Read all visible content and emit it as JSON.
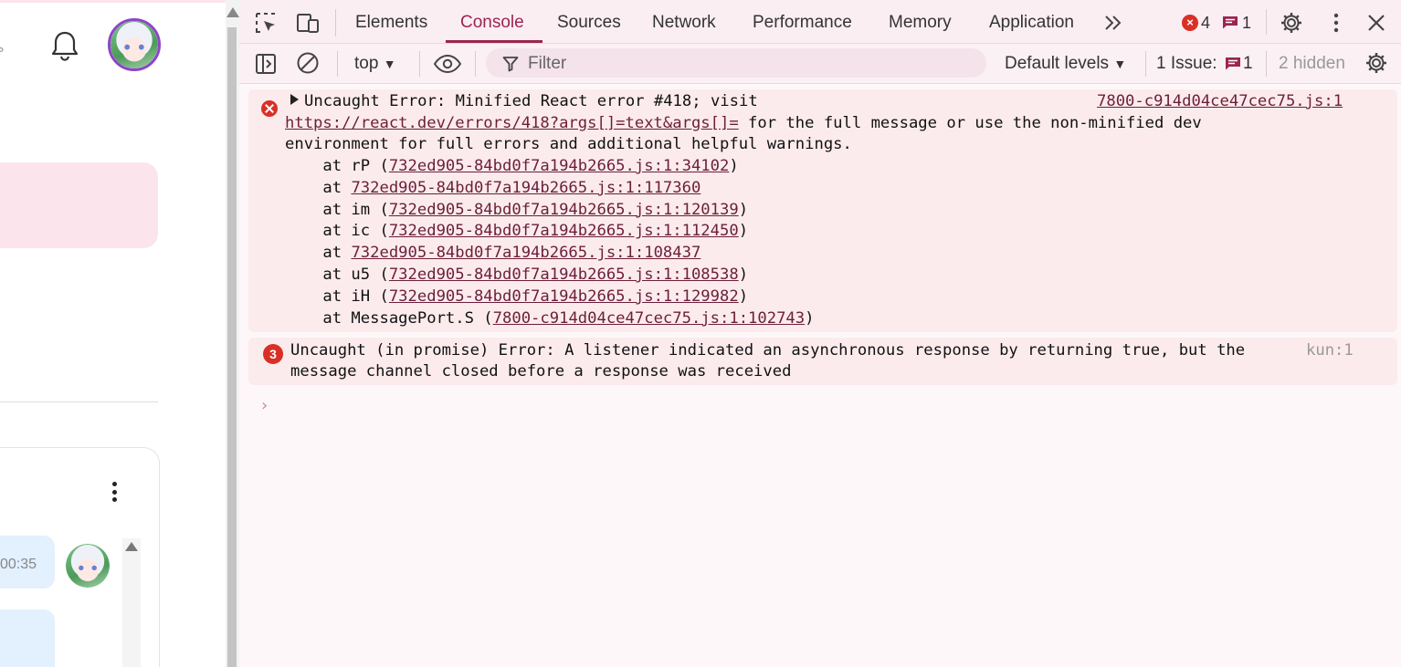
{
  "devtools": {
    "tabs": [
      "Elements",
      "Console",
      "Sources",
      "Network",
      "Performance",
      "Memory",
      "Application"
    ],
    "active_tab": "Console",
    "more_tabs_icon": "chevron-double-right-icon",
    "error_count": "4",
    "message_count": "1"
  },
  "toolbar": {
    "context": "top",
    "filter_placeholder": "Filter",
    "levels": "Default levels",
    "issues_label": "1 Issue:",
    "issues_count": "1",
    "hidden": "2 hidden"
  },
  "console": {
    "entry1": {
      "source": "7800-c914d04ce47cec75.js:1",
      "head": "Uncaught Error: Minified React error #418; visit",
      "url": "https://react.dev/errors/418?args[]=text&args[]=",
      "after_url": " for the full message or use the non-minified dev",
      "line3": "environment for full errors and additional helpful warnings.",
      "stack": [
        {
          "prefix": "    at rP (",
          "link": "732ed905-84bd0f7a194b2665.js:1:34102",
          "suffix": ")"
        },
        {
          "prefix": "    at ",
          "link": "732ed905-84bd0f7a194b2665.js:1:117360",
          "suffix": ""
        },
        {
          "prefix": "    at im (",
          "link": "732ed905-84bd0f7a194b2665.js:1:120139",
          "suffix": ")"
        },
        {
          "prefix": "    at ic (",
          "link": "732ed905-84bd0f7a194b2665.js:1:112450",
          "suffix": ")"
        },
        {
          "prefix": "    at ",
          "link": "732ed905-84bd0f7a194b2665.js:1:108437",
          "suffix": ""
        },
        {
          "prefix": "    at u5 (",
          "link": "732ed905-84bd0f7a194b2665.js:1:108538",
          "suffix": ")"
        },
        {
          "prefix": "    at iH (",
          "link": "732ed905-84bd0f7a194b2665.js:1:129982",
          "suffix": ")"
        },
        {
          "prefix": "    at MessagePort.S (",
          "link": "7800-c914d04ce47cec75.js:1:102743",
          "suffix": ")"
        }
      ]
    },
    "entry2": {
      "repeat": "3",
      "line1": "Uncaught (in promise) Error: A listener indicated an asynchronous response by returning true, but the",
      "line2": "message channel closed before a response was received",
      "source": "kun:1"
    },
    "prompt": "›"
  },
  "page": {
    "time": "00:35"
  },
  "colors": {
    "accent": "#9c2450",
    "error": "#d93025",
    "avatar_ring": "#8e44c8"
  }
}
